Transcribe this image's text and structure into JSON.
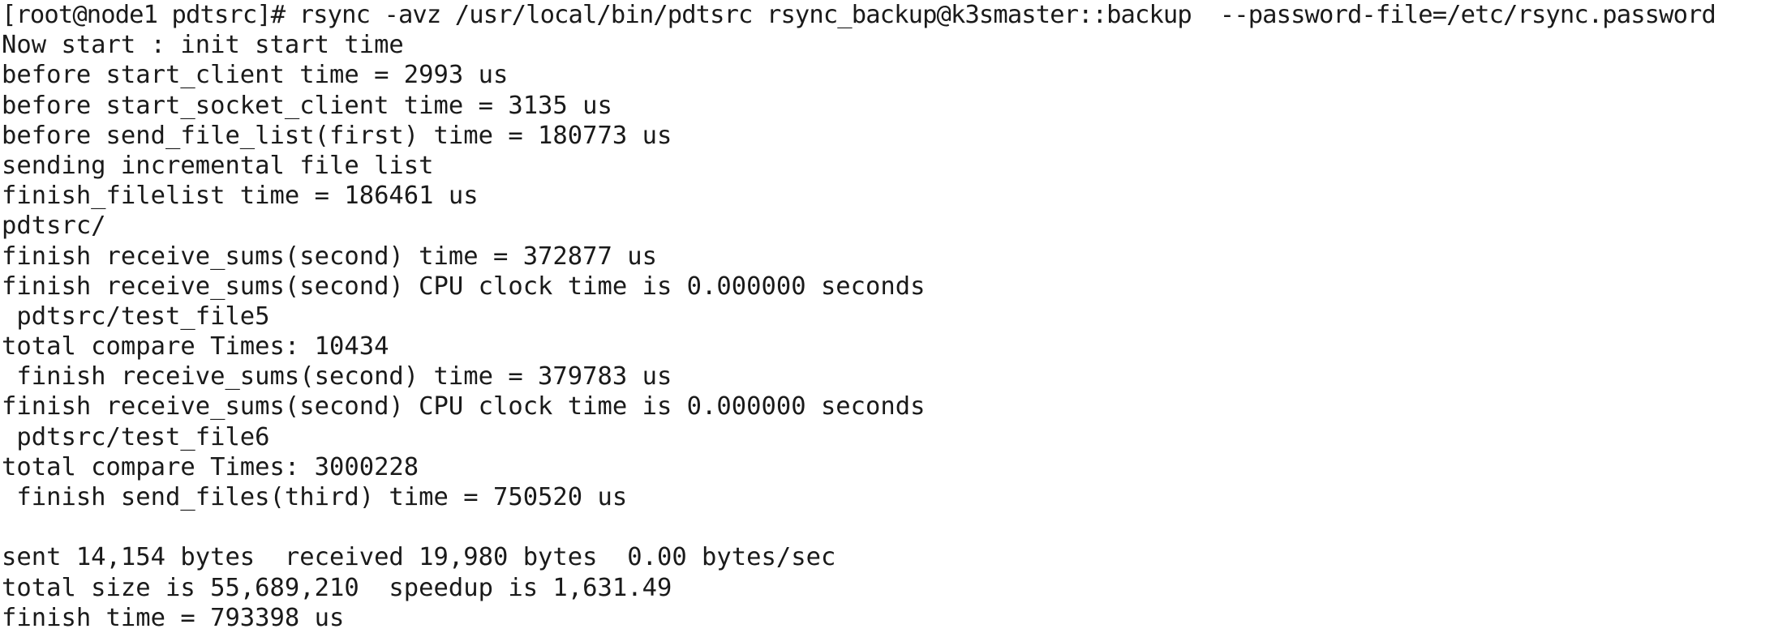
{
  "terminal": {
    "lines": [
      "[root@node1 pdtsrc]# rsync -avz /usr/local/bin/pdtsrc rsync_backup@k3smaster::backup  --password-file=/etc/rsync.password",
      "Now start : init start time",
      "before start_client time = 2993 us",
      "before start_socket_client time = 3135 us",
      "before send_file_list(first) time = 180773 us",
      "sending incremental file list",
      "finish_filelist time = 186461 us",
      "pdtsrc/",
      "finish receive_sums(second) time = 372877 us",
      "finish receive_sums(second) CPU clock time is 0.000000 seconds",
      " pdtsrc/test_file5",
      "total compare Times: 10434",
      " finish receive_sums(second) time = 379783 us",
      "finish receive_sums(second) CPU clock time is 0.000000 seconds",
      " pdtsrc/test_file6",
      "total compare Times: 3000228",
      " finish send_files(third) time = 750520 us",
      "",
      "sent 14,154 bytes  received 19,980 bytes  0.00 bytes/sec",
      "total size is 55,689,210  speedup is 1,631.49",
      "finish time = 793398 us"
    ]
  }
}
